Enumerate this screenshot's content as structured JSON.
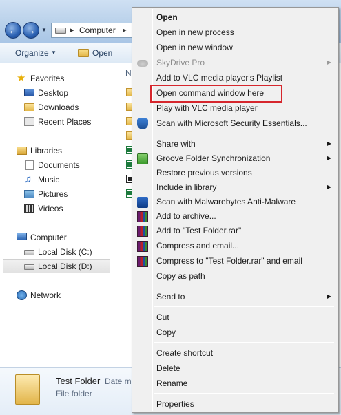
{
  "address": {
    "crumb": "Computer"
  },
  "toolbar": {
    "organize": "Organize",
    "open": "Open"
  },
  "navpane": {
    "favorites": "Favorites",
    "desktop": "Desktop",
    "downloads": "Downloads",
    "recent": "Recent Places",
    "libraries": "Libraries",
    "documents": "Documents",
    "music": "Music",
    "pictures": "Pictures",
    "videos": "Videos",
    "computer": "Computer",
    "disk_c": "Local Disk (C:)",
    "disk_d": "Local Disk (D:)",
    "network": "Network"
  },
  "content": {
    "column_header": "N"
  },
  "details": {
    "name": "Test Folder",
    "date_label": "Date m",
    "type": "File folder"
  },
  "menu": {
    "open": "Open",
    "open_new_process": "Open in new process",
    "open_new_window": "Open in new window",
    "skydrive": "SkyDrive Pro",
    "vlc_playlist": "Add to VLC media player's Playlist",
    "open_cmd": "Open command window here",
    "vlc_play": "Play with VLC media player",
    "mse_scan": "Scan with Microsoft Security Essentials...",
    "share_with": "Share with",
    "groove_sync": "Groove Folder Synchronization",
    "restore_versions": "Restore previous versions",
    "include_library": "Include in library",
    "malwarebytes": "Scan with Malwarebytes Anti-Malware",
    "add_archive": "Add to archive...",
    "add_rar": "Add to \"Test Folder.rar\"",
    "compress_email": "Compress and email...",
    "compress_rar_email": "Compress to \"Test Folder.rar\" and email",
    "copy_path": "Copy as path",
    "send_to": "Send to",
    "cut": "Cut",
    "copy": "Copy",
    "create_shortcut": "Create shortcut",
    "delete": "Delete",
    "rename": "Rename",
    "properties": "Properties"
  },
  "icons": {
    "nav_back": "back-arrow-icon",
    "nav_forward": "forward-arrow-icon",
    "submenu": "chevron-right-icon"
  },
  "colors": {
    "highlight_border": "#d6262d"
  }
}
